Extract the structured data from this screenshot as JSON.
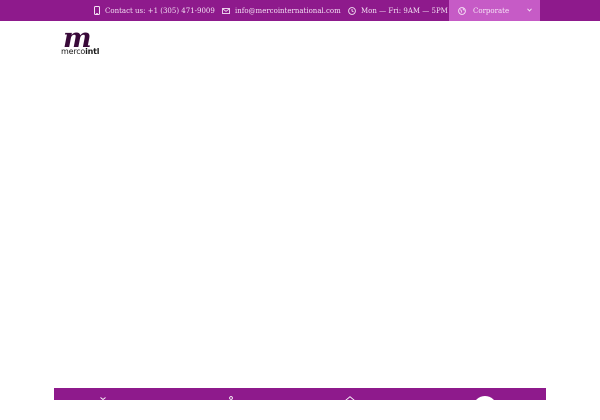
{
  "topbar": {
    "contact": {
      "icon": "phone-icon",
      "text": "Contact us: +1 (305) 471-9009"
    },
    "email": {
      "icon": "mail-icon",
      "text": "info@mercointernational.com"
    },
    "hours": {
      "icon": "clock-icon",
      "text": "Mon — Fri: 9AM — 5PM"
    },
    "region": {
      "icon": "globe-icon",
      "selected": "Corporate",
      "chevron": "chevron-down-icon"
    }
  },
  "logo": {
    "word_light": "merco",
    "word_bold": "intl",
    "mark": "m"
  },
  "bottom_nav": {
    "icons": [
      "nav-arrow-icon",
      "nav-user-icon",
      "nav-home-icon",
      "nav-circle-button"
    ]
  },
  "colors": {
    "brand": "#8e1a8c",
    "region_bg": "#c65bc6",
    "text_light": "#f3e1f3"
  }
}
